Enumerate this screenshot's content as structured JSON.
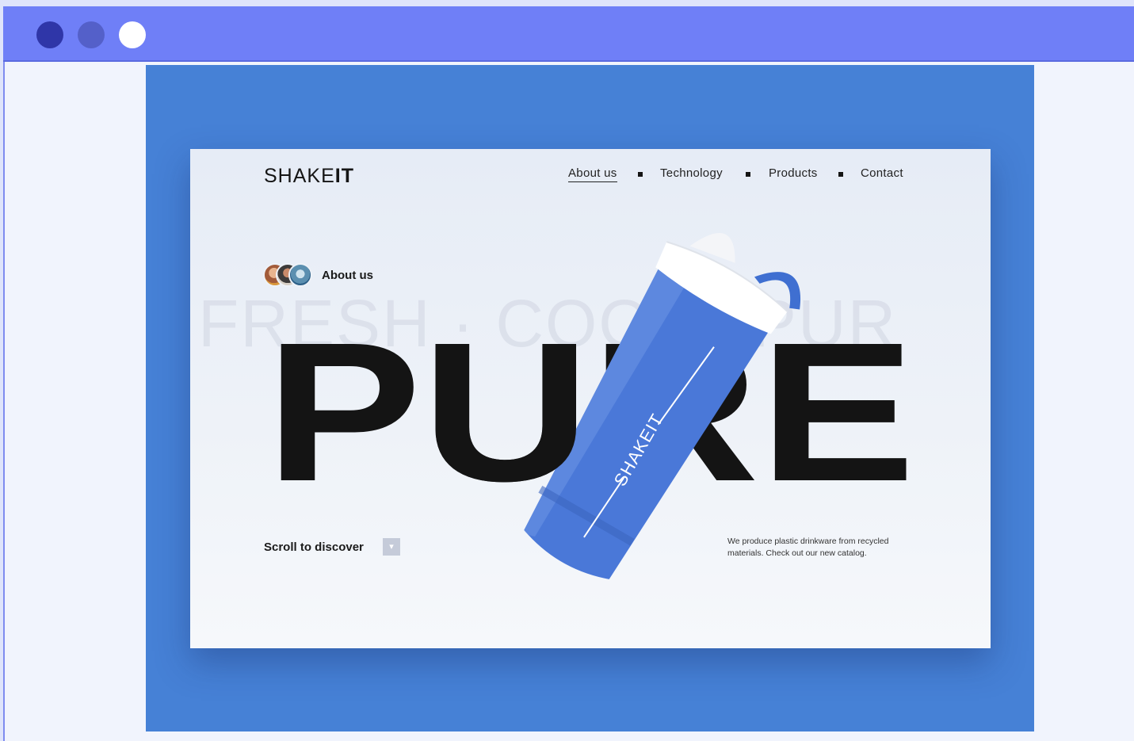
{
  "window": {
    "controls": [
      "close-dot",
      "minimize-dot",
      "maximize-dot"
    ],
    "colors": {
      "bar": "#6f7ff7",
      "frame": "#4681d6",
      "accent": "#4a78d8"
    }
  },
  "site": {
    "logo_light": "SHAKE",
    "logo_bold": "IT",
    "nav": [
      {
        "label": "About us",
        "active": true
      },
      {
        "label": "Technology",
        "active": false
      },
      {
        "label": "Products",
        "active": false
      },
      {
        "label": "Contact",
        "active": false
      }
    ],
    "about_chip_label": "About us",
    "background_words": "FRESH · COOL · PUR",
    "headline": "PURE",
    "bottle_brand": "SHAKEIT",
    "scroll_label": "Scroll to discover",
    "scroll_icon": "chevron-down-icon",
    "tagline": "We produce plastic drinkware from recycled materials. Check out our new catalog."
  }
}
